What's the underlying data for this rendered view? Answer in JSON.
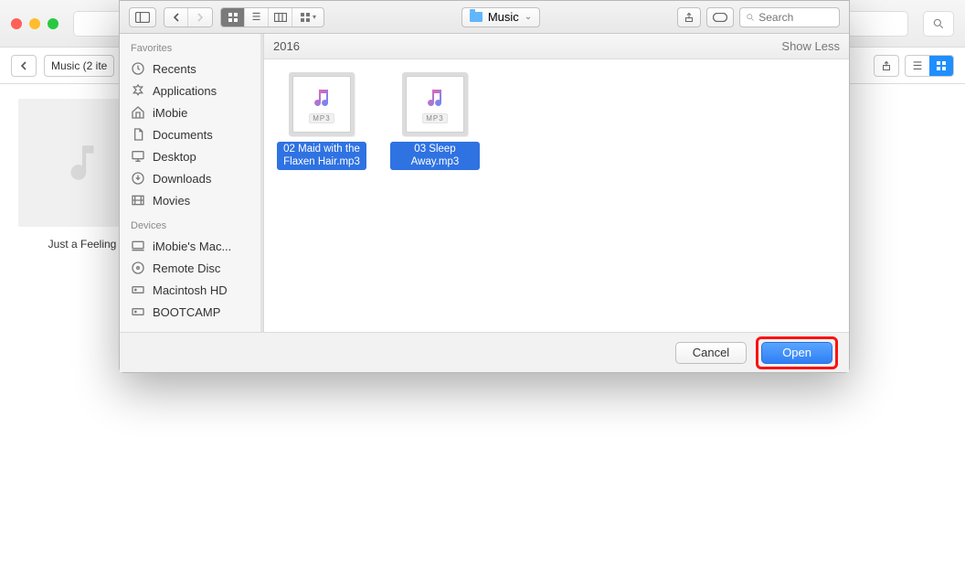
{
  "bg": {
    "breadcrumb": "Music (2 ite",
    "thumb_label": "Just a Feeling"
  },
  "dialog": {
    "folder": "Music",
    "search_placeholder": "Search",
    "header": {
      "section": "2016",
      "toggle": "Show Less"
    },
    "sidebar": {
      "favorites_label": "Favorites",
      "devices_label": "Devices",
      "favorites": [
        {
          "icon": "clock-icon",
          "label": "Recents"
        },
        {
          "icon": "apps-icon",
          "label": "Applications"
        },
        {
          "icon": "home-icon",
          "label": "iMobie"
        },
        {
          "icon": "documents-icon",
          "label": "Documents"
        },
        {
          "icon": "desktop-icon",
          "label": "Desktop"
        },
        {
          "icon": "downloads-icon",
          "label": "Downloads"
        },
        {
          "icon": "movies-icon",
          "label": "Movies"
        }
      ],
      "devices": [
        {
          "icon": "mac-icon",
          "label": "iMobie's Mac..."
        },
        {
          "icon": "disc-icon",
          "label": "Remote Disc"
        },
        {
          "icon": "hdd-icon",
          "label": "Macintosh HD"
        },
        {
          "icon": "hdd-icon",
          "label": "BOOTCAMP"
        }
      ]
    },
    "files": [
      {
        "name": "02 Maid with the Flaxen Hair.mp3",
        "badge": "MP3",
        "selected": true
      },
      {
        "name": "03 Sleep Away.mp3",
        "badge": "MP3",
        "selected": true
      }
    ],
    "buttons": {
      "cancel": "Cancel",
      "open": "Open"
    }
  }
}
